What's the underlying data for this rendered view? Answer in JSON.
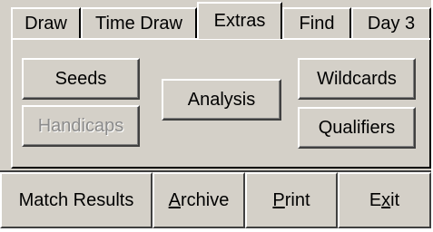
{
  "tabs": [
    {
      "label": "Draw"
    },
    {
      "label": "Time Draw"
    },
    {
      "label": "Extras",
      "active": true
    },
    {
      "label": "Find"
    },
    {
      "label": "Day 3"
    }
  ],
  "extras_panel": {
    "seeds_label": "Seeds",
    "handicaps_label": "Handicaps",
    "analysis_label": "Analysis",
    "wildcards_label": "Wildcards",
    "qualifiers_label": "Qualifiers"
  },
  "bottom_bar": {
    "match_results_label": "Match Results",
    "archive": {
      "mnemonic": "A",
      "rest": "rchive"
    },
    "print": {
      "mnemonic": "P",
      "rest": "rint"
    },
    "exit": {
      "before": "E",
      "mnemonic": "x",
      "after": "it"
    }
  },
  "colors": {
    "face": "#d4d0c8",
    "highlight": "#ffffff",
    "shadow": "#404040",
    "disabled_text": "#8a8a8a"
  }
}
